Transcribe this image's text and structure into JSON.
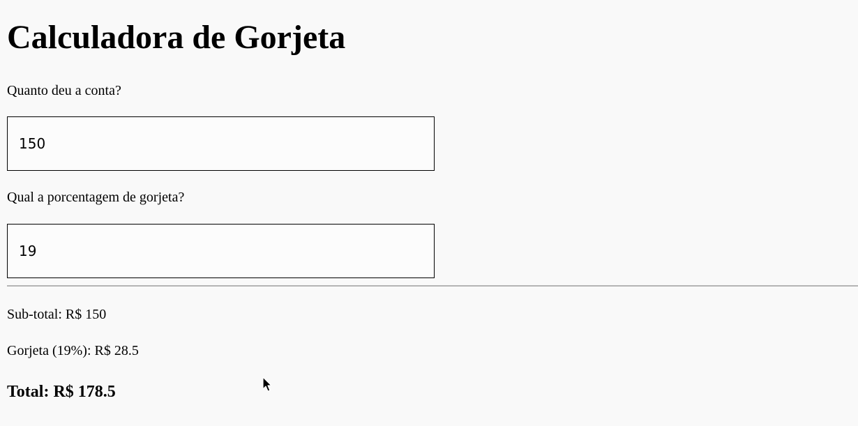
{
  "header": {
    "title": "Calculadora de Gorjeta"
  },
  "form": {
    "bill": {
      "label": "Quanto deu a conta?",
      "value": "150"
    },
    "tip": {
      "label": "Qual a porcentagem de gorjeta?",
      "value": "19"
    }
  },
  "results": {
    "subtotal": "Sub-total: R$ 150",
    "tip": "Gorjeta (19%): R$ 28.5",
    "total": "Total: R$ 178.5"
  },
  "icons": {
    "cursor": "mouse-pointer-icon"
  },
  "colors": {
    "background": "#f9f9f9",
    "divider": "#b4b4b4",
    "text": "#000000"
  }
}
